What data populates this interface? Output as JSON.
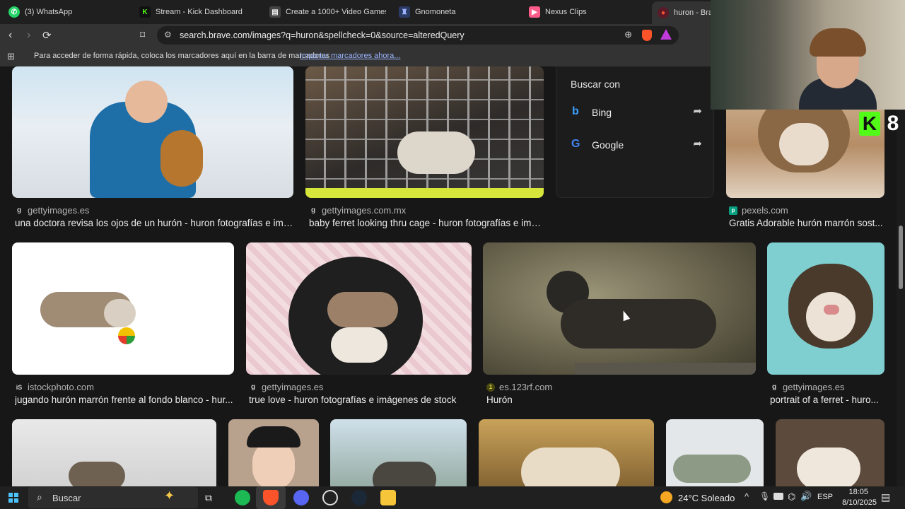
{
  "tabs": [
    {
      "label": "(3) WhatsApp",
      "icon": "whatsapp-icon",
      "color": "#25d366"
    },
    {
      "label": "Stream - Kick Dashboard",
      "icon": "kick-icon",
      "color": "#53fc18"
    },
    {
      "label": "Create a 1000+ Video Games Tr",
      "icon": "document-icon",
      "color": "#e8e8e8"
    },
    {
      "label": "Gnomoneta",
      "icon": "gnome-icon",
      "color": "#9fb3ff"
    },
    {
      "label": "Nexus Clips",
      "icon": "nexus-icon",
      "color": "#ff5c8a"
    },
    {
      "label": "huron - Brav",
      "icon": "brave-icon",
      "color": "#fb542b"
    }
  ],
  "address_bar": {
    "url": "search.brave.com/images?q=huron&spellcheck=0&source=alteredQuery"
  },
  "bookmarks_bar": {
    "message": "Para acceder de forma rápida, coloca los marcadores aquí en la barra de marcadores",
    "link": "Importar marcadores ahora..."
  },
  "search_with": {
    "title": "Buscar con",
    "engines": [
      {
        "name": "Bing",
        "icon": "bing-icon"
      },
      {
        "name": "Google",
        "icon": "google-icon"
      }
    ]
  },
  "results": {
    "row1": [
      {
        "source": "gettyimages.es",
        "caption": "una doctora revisa los ojos de un hurón - huron fotografías e imá..."
      },
      {
        "source": "gettyimages.com.mx",
        "caption": "baby ferret looking thru cage - huron fotografías e imá..."
      },
      {
        "source": "pexels.com",
        "caption": "Gratis Adorable hurón marrón sost..."
      }
    ],
    "row2": [
      {
        "source": "istockphoto.com",
        "caption": "jugando hurón marrón frente al fondo blanco - hur..."
      },
      {
        "source": "gettyimages.es",
        "caption": "true love - huron fotografías e imágenes de stock"
      },
      {
        "source": "es.123rf.com",
        "caption": "Hurón"
      },
      {
        "source": "gettyimages.es",
        "caption": "portrait of a ferret - huro..."
      }
    ]
  },
  "overlay": {
    "kick_label": "8"
  },
  "taskbar": {
    "search_placeholder": "Buscar",
    "weather": "24°C  Soleado",
    "language": "ESP",
    "time": "18:05",
    "date": "8/10/2025"
  }
}
